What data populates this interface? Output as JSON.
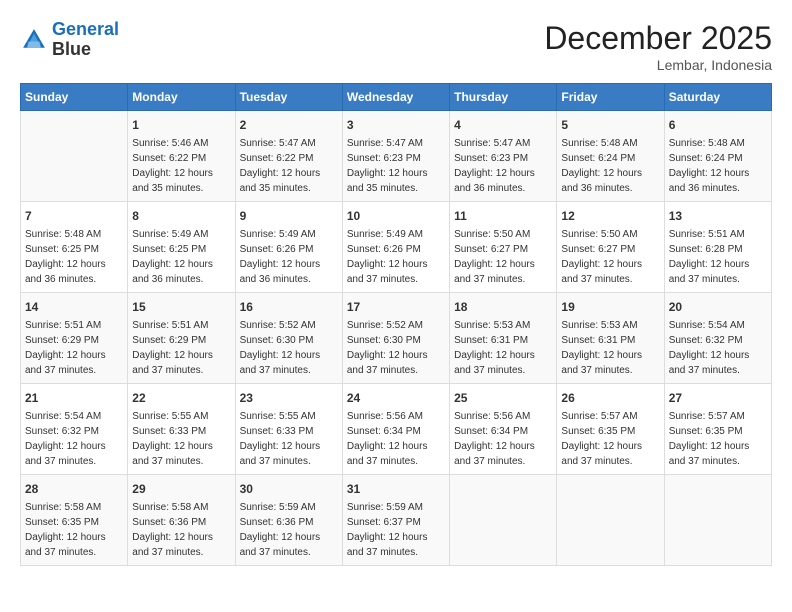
{
  "header": {
    "logo_line1": "General",
    "logo_line2": "Blue",
    "month": "December 2025",
    "location": "Lembar, Indonesia"
  },
  "days_of_week": [
    "Sunday",
    "Monday",
    "Tuesday",
    "Wednesday",
    "Thursday",
    "Friday",
    "Saturday"
  ],
  "weeks": [
    [
      {
        "day": "",
        "sunrise": "",
        "sunset": "",
        "daylight": ""
      },
      {
        "day": "1",
        "sunrise": "Sunrise: 5:46 AM",
        "sunset": "Sunset: 6:22 PM",
        "daylight": "Daylight: 12 hours and 35 minutes."
      },
      {
        "day": "2",
        "sunrise": "Sunrise: 5:47 AM",
        "sunset": "Sunset: 6:22 PM",
        "daylight": "Daylight: 12 hours and 35 minutes."
      },
      {
        "day": "3",
        "sunrise": "Sunrise: 5:47 AM",
        "sunset": "Sunset: 6:23 PM",
        "daylight": "Daylight: 12 hours and 35 minutes."
      },
      {
        "day": "4",
        "sunrise": "Sunrise: 5:47 AM",
        "sunset": "Sunset: 6:23 PM",
        "daylight": "Daylight: 12 hours and 36 minutes."
      },
      {
        "day": "5",
        "sunrise": "Sunrise: 5:48 AM",
        "sunset": "Sunset: 6:24 PM",
        "daylight": "Daylight: 12 hours and 36 minutes."
      },
      {
        "day": "6",
        "sunrise": "Sunrise: 5:48 AM",
        "sunset": "Sunset: 6:24 PM",
        "daylight": "Daylight: 12 hours and 36 minutes."
      }
    ],
    [
      {
        "day": "7",
        "sunrise": "Sunrise: 5:48 AM",
        "sunset": "Sunset: 6:25 PM",
        "daylight": "Daylight: 12 hours and 36 minutes."
      },
      {
        "day": "8",
        "sunrise": "Sunrise: 5:49 AM",
        "sunset": "Sunset: 6:25 PM",
        "daylight": "Daylight: 12 hours and 36 minutes."
      },
      {
        "day": "9",
        "sunrise": "Sunrise: 5:49 AM",
        "sunset": "Sunset: 6:26 PM",
        "daylight": "Daylight: 12 hours and 36 minutes."
      },
      {
        "day": "10",
        "sunrise": "Sunrise: 5:49 AM",
        "sunset": "Sunset: 6:26 PM",
        "daylight": "Daylight: 12 hours and 37 minutes."
      },
      {
        "day": "11",
        "sunrise": "Sunrise: 5:50 AM",
        "sunset": "Sunset: 6:27 PM",
        "daylight": "Daylight: 12 hours and 37 minutes."
      },
      {
        "day": "12",
        "sunrise": "Sunrise: 5:50 AM",
        "sunset": "Sunset: 6:27 PM",
        "daylight": "Daylight: 12 hours and 37 minutes."
      },
      {
        "day": "13",
        "sunrise": "Sunrise: 5:51 AM",
        "sunset": "Sunset: 6:28 PM",
        "daylight": "Daylight: 12 hours and 37 minutes."
      }
    ],
    [
      {
        "day": "14",
        "sunrise": "Sunrise: 5:51 AM",
        "sunset": "Sunset: 6:29 PM",
        "daylight": "Daylight: 12 hours and 37 minutes."
      },
      {
        "day": "15",
        "sunrise": "Sunrise: 5:51 AM",
        "sunset": "Sunset: 6:29 PM",
        "daylight": "Daylight: 12 hours and 37 minutes."
      },
      {
        "day": "16",
        "sunrise": "Sunrise: 5:52 AM",
        "sunset": "Sunset: 6:30 PM",
        "daylight": "Daylight: 12 hours and 37 minutes."
      },
      {
        "day": "17",
        "sunrise": "Sunrise: 5:52 AM",
        "sunset": "Sunset: 6:30 PM",
        "daylight": "Daylight: 12 hours and 37 minutes."
      },
      {
        "day": "18",
        "sunrise": "Sunrise: 5:53 AM",
        "sunset": "Sunset: 6:31 PM",
        "daylight": "Daylight: 12 hours and 37 minutes."
      },
      {
        "day": "19",
        "sunrise": "Sunrise: 5:53 AM",
        "sunset": "Sunset: 6:31 PM",
        "daylight": "Daylight: 12 hours and 37 minutes."
      },
      {
        "day": "20",
        "sunrise": "Sunrise: 5:54 AM",
        "sunset": "Sunset: 6:32 PM",
        "daylight": "Daylight: 12 hours and 37 minutes."
      }
    ],
    [
      {
        "day": "21",
        "sunrise": "Sunrise: 5:54 AM",
        "sunset": "Sunset: 6:32 PM",
        "daylight": "Daylight: 12 hours and 37 minutes."
      },
      {
        "day": "22",
        "sunrise": "Sunrise: 5:55 AM",
        "sunset": "Sunset: 6:33 PM",
        "daylight": "Daylight: 12 hours and 37 minutes."
      },
      {
        "day": "23",
        "sunrise": "Sunrise: 5:55 AM",
        "sunset": "Sunset: 6:33 PM",
        "daylight": "Daylight: 12 hours and 37 minutes."
      },
      {
        "day": "24",
        "sunrise": "Sunrise: 5:56 AM",
        "sunset": "Sunset: 6:34 PM",
        "daylight": "Daylight: 12 hours and 37 minutes."
      },
      {
        "day": "25",
        "sunrise": "Sunrise: 5:56 AM",
        "sunset": "Sunset: 6:34 PM",
        "daylight": "Daylight: 12 hours and 37 minutes."
      },
      {
        "day": "26",
        "sunrise": "Sunrise: 5:57 AM",
        "sunset": "Sunset: 6:35 PM",
        "daylight": "Daylight: 12 hours and 37 minutes."
      },
      {
        "day": "27",
        "sunrise": "Sunrise: 5:57 AM",
        "sunset": "Sunset: 6:35 PM",
        "daylight": "Daylight: 12 hours and 37 minutes."
      }
    ],
    [
      {
        "day": "28",
        "sunrise": "Sunrise: 5:58 AM",
        "sunset": "Sunset: 6:35 PM",
        "daylight": "Daylight: 12 hours and 37 minutes."
      },
      {
        "day": "29",
        "sunrise": "Sunrise: 5:58 AM",
        "sunset": "Sunset: 6:36 PM",
        "daylight": "Daylight: 12 hours and 37 minutes."
      },
      {
        "day": "30",
        "sunrise": "Sunrise: 5:59 AM",
        "sunset": "Sunset: 6:36 PM",
        "daylight": "Daylight: 12 hours and 37 minutes."
      },
      {
        "day": "31",
        "sunrise": "Sunrise: 5:59 AM",
        "sunset": "Sunset: 6:37 PM",
        "daylight": "Daylight: 12 hours and 37 minutes."
      },
      {
        "day": "",
        "sunrise": "",
        "sunset": "",
        "daylight": ""
      },
      {
        "day": "",
        "sunrise": "",
        "sunset": "",
        "daylight": ""
      },
      {
        "day": "",
        "sunrise": "",
        "sunset": "",
        "daylight": ""
      }
    ]
  ]
}
